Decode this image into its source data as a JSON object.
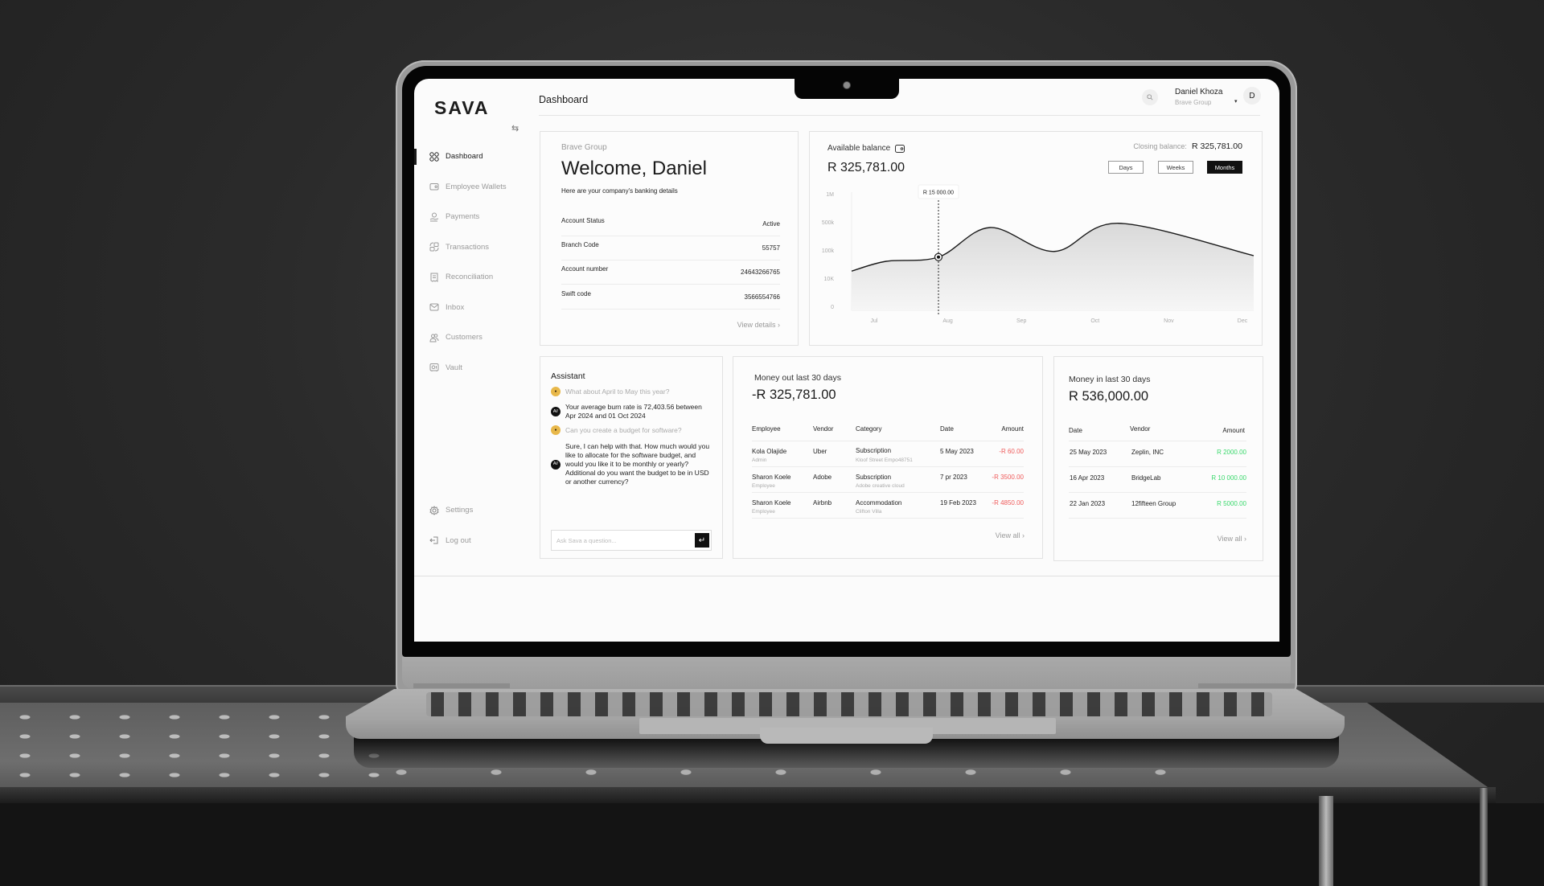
{
  "app": {
    "logo": "SAVA",
    "page_title": "Dashboard"
  },
  "user": {
    "name": "Daniel Khoza",
    "org": "Brave Group",
    "avatar_initial": "D"
  },
  "icons": {
    "search": "search-icon",
    "collapse": "swap-arrows-icon",
    "wallet": "wallet-icon",
    "chevron": "chevron-right-icon",
    "send": "enter-icon",
    "caret": "caret-down-icon"
  },
  "sidebar": {
    "items": [
      {
        "label": "Dashboard",
        "icon": "grid-icon",
        "active": true
      },
      {
        "label": "Employee Wallets",
        "icon": "wallet-icon"
      },
      {
        "label": "Payments",
        "icon": "hand-coin-icon"
      },
      {
        "label": "Transactions",
        "icon": "transactions-icon"
      },
      {
        "label": "Reconciliation",
        "icon": "receipt-icon"
      },
      {
        "label": "Inbox",
        "icon": "mail-icon"
      },
      {
        "label": "Customers",
        "icon": "users-icon"
      },
      {
        "label": "Vault",
        "icon": "vault-icon"
      }
    ],
    "bottom": [
      {
        "label": "Settings",
        "icon": "gear-icon"
      },
      {
        "label": "Log out",
        "icon": "logout-icon"
      }
    ]
  },
  "welcome": {
    "org": "Brave Group",
    "title": "Welcome, Daniel",
    "subtitle": "Here are your company's banking details",
    "details": [
      {
        "key": "Account Status",
        "value": "Active"
      },
      {
        "key": "Branch Code",
        "value": "55757"
      },
      {
        "key": "Account number",
        "value": "24643266765"
      },
      {
        "key": "Swift code",
        "value": "3566554766"
      }
    ],
    "link": "View details"
  },
  "balance": {
    "label": "Available balance",
    "value": "R 325,781.00",
    "closing_label": "Closing balance:",
    "closing_value": "R 325,781.00",
    "ranges": [
      {
        "label": "Days",
        "active": false
      },
      {
        "label": "Weeks",
        "active": false
      },
      {
        "label": "Months",
        "active": true
      }
    ]
  },
  "chart_data": {
    "type": "area",
    "title": "Available balance",
    "x": [
      "Jul",
      "Aug",
      "Sep",
      "Oct",
      "Nov",
      "Dec"
    ],
    "y_ticks": [
      "0",
      "10K",
      "100k",
      "500k",
      "1M"
    ],
    "y_scale": "log-like (ordinal tick spacing)",
    "series": [
      {
        "name": "Balance",
        "points": [
          {
            "x": "Jul (start)",
            "y_tick_pos": 1.25
          },
          {
            "x": "Jul",
            "y_tick_pos": 1.6
          },
          {
            "x": "Aug",
            "y_tick_pos": 1.75
          },
          {
            "x": "Sep",
            "y_tick_pos": 2.8
          },
          {
            "x": "Oct",
            "y_tick_pos": 1.95
          },
          {
            "x": "Nov",
            "y_tick_pos": 2.95
          },
          {
            "x": "Dec",
            "y_tick_pos": 1.8
          }
        ]
      }
    ],
    "tooltip": {
      "x": "Aug",
      "label": "R 15 000.00"
    },
    "grid": false,
    "legend": "none"
  },
  "assistant": {
    "title": "Assistant",
    "messages": [
      {
        "role": "user",
        "text": "What about April to May this year?"
      },
      {
        "role": "bot",
        "text": "Your average burn rate is 72,403.56 between Apr 2024 and 01 Oct 2024"
      },
      {
        "role": "user",
        "text": "Can you create a budget for software?"
      },
      {
        "role": "bot",
        "text": "Sure, I can help with that. How much would you like to allocate for the software budget, and would you like it to be monthly or yearly? Additional do you want the budget to be in USD or another currency?"
      }
    ],
    "bot_badge": "AV",
    "input_placeholder": "Ask Sava a question..."
  },
  "money_out": {
    "title": "Money out last 30 days",
    "value": "-R 325,781.00",
    "columns": [
      "Employee",
      "Vendor",
      "Category",
      "Date",
      "Amount"
    ],
    "rows": [
      {
        "employee": "Kola Olajide",
        "role": "Admin",
        "vendor": "Uber",
        "category": "Subscription",
        "category_sub": "Kloof Street Empo48751",
        "date": "5 May 2023",
        "amount": "-R 60.00"
      },
      {
        "employee": "Sharon Koele",
        "role": "Employee",
        "vendor": "Adobe",
        "category": "Subscription",
        "category_sub": "Adobe creative cloud",
        "date": "7 pr 2023",
        "amount": "-R 3500.00"
      },
      {
        "employee": "Sharon Koele",
        "role": "Employee",
        "vendor": "Airbnb",
        "category": "Accommodation",
        "category_sub": "Clifton Villa",
        "date": "19 Feb 2023",
        "amount": "-R 4850.00"
      }
    ],
    "link": "View all",
    "amount_color": "#ef5b5b"
  },
  "money_in": {
    "title": "Money in last 30 days",
    "value": "R 536,000.00",
    "columns": [
      "Date",
      "Vendor",
      "Amount"
    ],
    "rows": [
      {
        "date": "25 May 2023",
        "vendor": "Zeplin, INC",
        "amount": "R 2000.00"
      },
      {
        "date": "16 Apr 2023",
        "vendor": "BridgeLab",
        "amount": "R 10 000.00"
      },
      {
        "date": "22 Jan 2023",
        "vendor": "12fifteen Group",
        "amount": "R 5000.00"
      }
    ],
    "link": "View all",
    "amount_color": "#3bd96d"
  }
}
